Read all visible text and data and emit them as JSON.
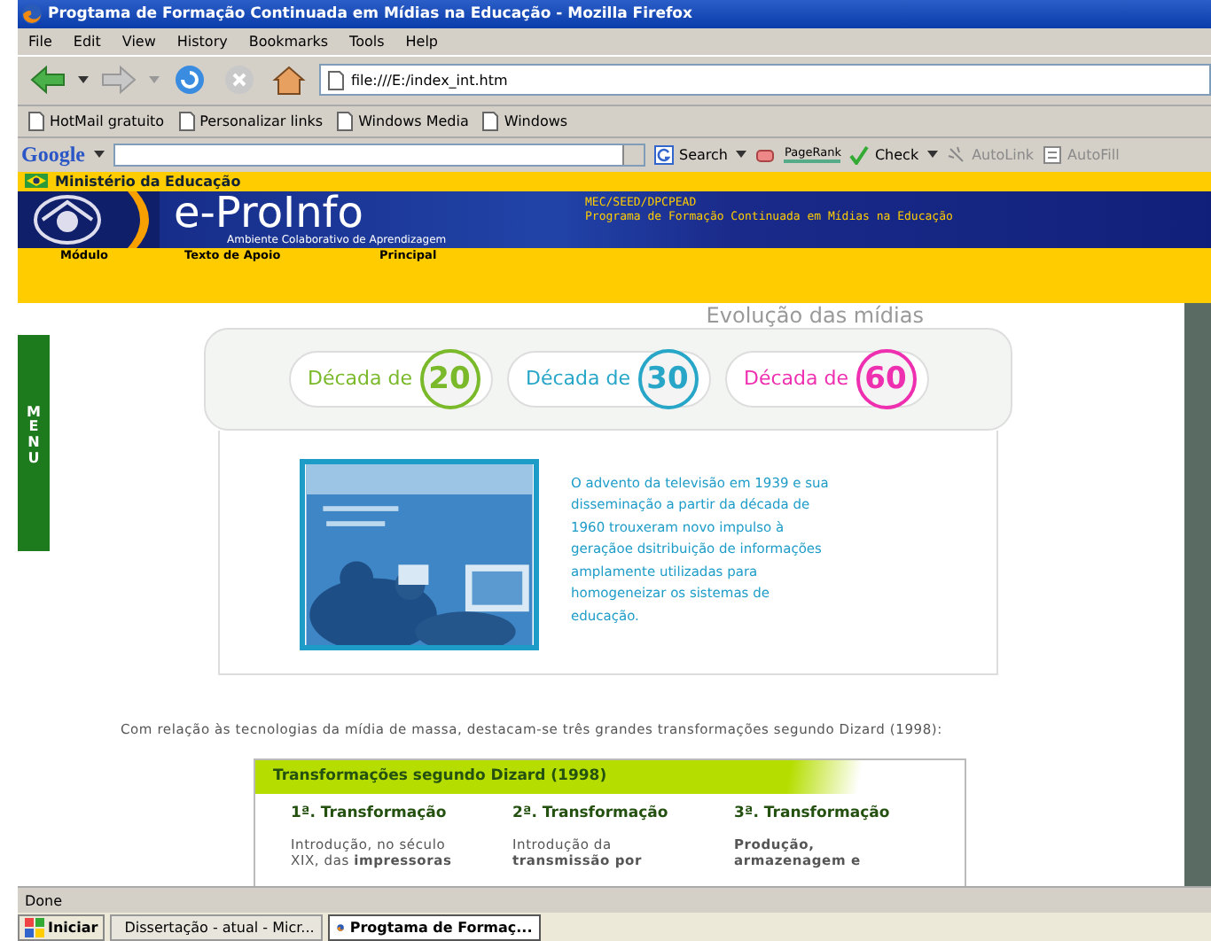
{
  "window": {
    "title": "Progtama de Formação Continuada em Mídias na Educação - Mozilla Firefox"
  },
  "menu_bar": [
    "File",
    "Edit",
    "View",
    "History",
    "Bookmarks",
    "Tools",
    "Help"
  ],
  "address": {
    "value": "file:///E:/index_int.htm"
  },
  "bookmarks": [
    "HotMail gratuito",
    "Personalizar links",
    "Windows Media",
    "Windows"
  ],
  "google_toolbar": {
    "logo": "Google",
    "buttons": [
      {
        "label": "Search",
        "kind": "search",
        "disabled": false
      },
      {
        "label": "PageRank",
        "kind": "pagerank",
        "disabled": false
      },
      {
        "label": "Check",
        "kind": "check",
        "disabled": false
      },
      {
        "label": "AutoLink",
        "kind": "autolink",
        "disabled": true
      },
      {
        "label": "AutoFill",
        "kind": "autofill",
        "disabled": true
      }
    ]
  },
  "site_header": {
    "ministry": "Ministério da Educação",
    "logo": "e-ProInfo",
    "tagline": "Ambiente Colaborativo de Aprendizagem",
    "org": "MEC/SEED/DPCPEAD",
    "program": "Programa de Formação Continuada em Mídias na Educação",
    "nav": [
      "Módulo",
      "Texto de Apoio",
      "Principal"
    ]
  },
  "side_tab": "MENU",
  "media": {
    "title": "Evolução das mídias",
    "decades": [
      {
        "label": "Década de",
        "number": "20",
        "color": "#7ab929"
      },
      {
        "label": "Década de",
        "number": "30",
        "color": "#27a6c8"
      },
      {
        "label": "Década de",
        "number": "60",
        "color": "#ee2fb0"
      }
    ],
    "caption": "O advento da televisão em 1939 e sua disseminação a partir da década de 1960 trouxeram novo impulso à geraçãoe dsitribuição de informações amplamente utilizadas para homogeneizar os sistemas de educação."
  },
  "intro": "Com relação às tecnologias da mídia de massa, destacam-se três grandes transformações segundo Dizard (1998):",
  "dizard": {
    "title": "Transformações segundo Dizard (1998)",
    "columns": [
      {
        "heading": "1ª. Transformação",
        "text": "Introdução, no século XIX, das **impressoras**"
      },
      {
        "heading": "2ª. Transformação",
        "text": "Introdução da **transmissão por**"
      },
      {
        "heading": "3ª. Transformação",
        "text": "**Produção, armazenagem e**"
      }
    ]
  },
  "status_bar": "Done",
  "taskbar": {
    "start": "Iniciar",
    "tasks": [
      {
        "label": "Dissertação - atual - Micr...",
        "selected": false
      },
      {
        "label": "Progtama de Formaç...",
        "selected": true
      }
    ]
  }
}
